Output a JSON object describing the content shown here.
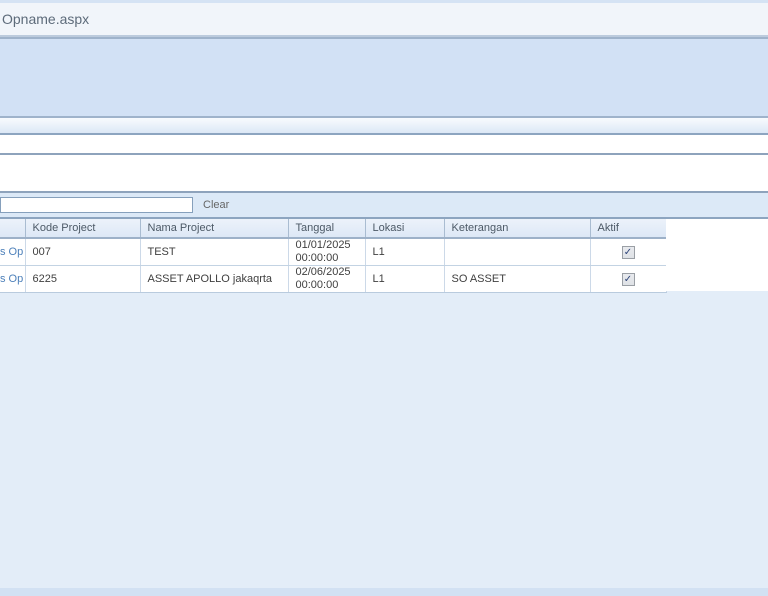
{
  "window": {
    "title": "Opname.aspx"
  },
  "search": {
    "input_value": "",
    "clear_label": "Clear"
  },
  "table": {
    "columns": {
      "action": "",
      "kode": "Kode Project",
      "nama": "Nama Project",
      "tanggal": "Tanggal",
      "lokasi": "Lokasi",
      "keterangan": "Keterangan",
      "aktif": "Aktif"
    },
    "rows": [
      {
        "action_link": "s Op",
        "kode": "007",
        "nama": "TEST",
        "tanggal_date": "01/01/2025",
        "tanggal_time": "00:00:00",
        "lokasi": "L1",
        "keterangan": "",
        "aktif_checked": "✓"
      },
      {
        "action_link": "s Op",
        "kode": "6225",
        "nama": "ASSET APOLLO jakaqrta",
        "tanggal_date": "02/06/2025",
        "tanggal_time": "00:00:00",
        "lokasi": "L1",
        "keterangan": "SO ASSET",
        "aktif_checked": "✓"
      }
    ]
  },
  "colors": {
    "page_background": "#e3edf8",
    "panel_blue": "#d2e1f5",
    "band_border": "#8da5c0",
    "header_text": "#4c5966",
    "link_blue": "#4d80ba",
    "checkbox_check": "#2d4377"
  }
}
